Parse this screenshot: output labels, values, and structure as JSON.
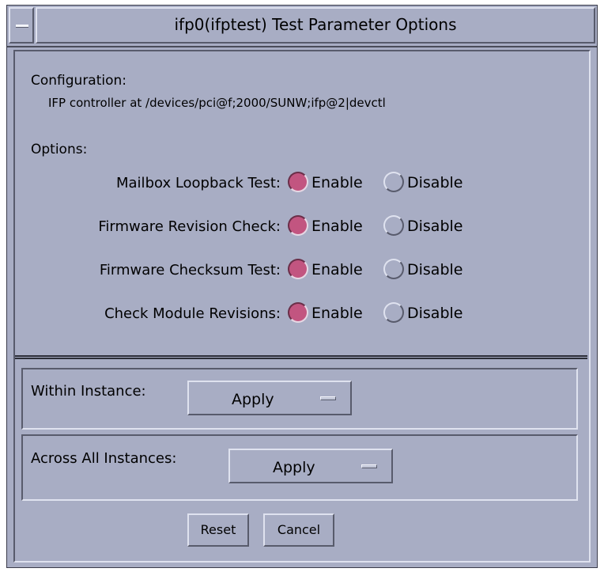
{
  "window": {
    "title": "ifp0(ifptest) Test Parameter Options"
  },
  "configuration": {
    "heading": "Configuration:",
    "value": "IFP controller at /devices/pci@f;2000/SUNW;ifp@2|devctl"
  },
  "options": {
    "heading": "Options:",
    "rows": [
      {
        "label": "Mailbox Loopback Test:",
        "enable": "Enable",
        "disable": "Disable",
        "selected": "Enable"
      },
      {
        "label": "Firmware Revision Check:",
        "enable": "Enable",
        "disable": "Disable",
        "selected": "Enable"
      },
      {
        "label": "Firmware Checksum Test:",
        "enable": "Enable",
        "disable": "Disable",
        "selected": "Enable"
      },
      {
        "label": "Check Module Revisions:",
        "enable": "Enable",
        "disable": "Disable",
        "selected": "Enable"
      }
    ]
  },
  "within_instance": {
    "label": "Within Instance:",
    "value": "Apply"
  },
  "across_instances": {
    "label": "Across All Instances:",
    "value": "Apply"
  },
  "buttons": {
    "reset": "Reset",
    "cancel": "Cancel"
  },
  "colors": {
    "background": "#a8adc4",
    "radio_selected": "#c25580"
  },
  "icons": {
    "window_menu": "window-menu-icon",
    "option_indicator": "option-menu-indicator-icon"
  }
}
